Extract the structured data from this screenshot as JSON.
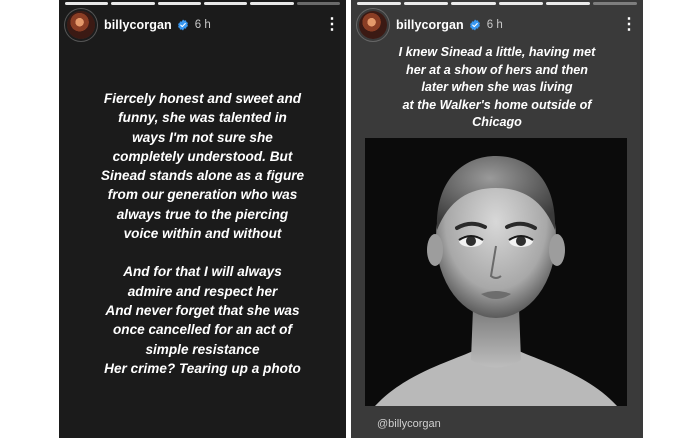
{
  "left_story": {
    "progress_segments": [
      1,
      1,
      1,
      1,
      1,
      0
    ],
    "header": {
      "username": "billycorgan",
      "time": "6 h",
      "more_icon": "⋮"
    },
    "paragraph1": "Fiercely honest and sweet and\nfunny, she was talented in\nways I'm not sure she\ncompletely understood. But\nSinead stands alone as a figure\nfrom our generation who was\nalways true to the piercing\nvoice within and without",
    "paragraph2": "And for that I will always\nadmire and respect her\nAnd never forget that she was\nonce cancelled for an act of\nsimple resistance\nHer crime? Tearing up a photo"
  },
  "right_story": {
    "progress_segments": [
      1,
      1,
      1,
      1,
      1,
      0
    ],
    "header": {
      "username": "billycorgan",
      "time": "6 h",
      "more_icon": "⋮"
    },
    "caption": "I knew Sinead a little, having met\nher at a show of hers and then\nlater when she was living\nat the Walker's home outside of\nChicago",
    "mention": "@billycorgan"
  },
  "colors": {
    "verified": "#3897f0",
    "story_left_bg": "#1b1b1b",
    "story_right_bg": "#3a3a3a"
  }
}
